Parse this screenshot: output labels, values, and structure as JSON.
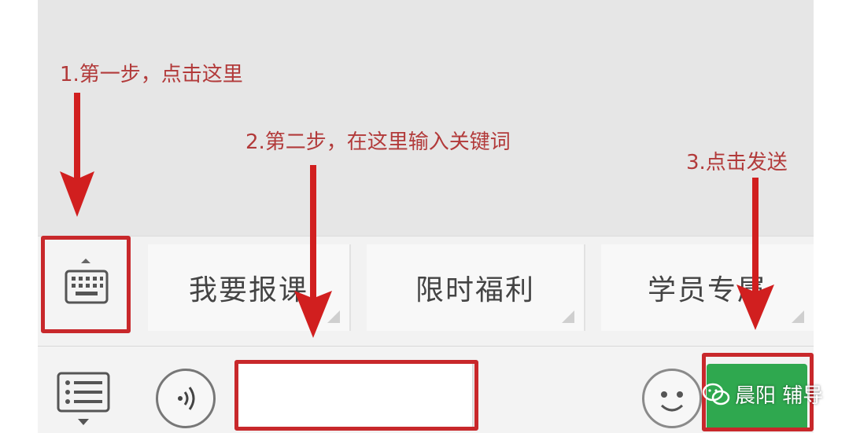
{
  "annotations": {
    "step1": "1.第一步，点击这里",
    "step2": "2.第二步，在这里输入关键词",
    "step3": "3.点击发送"
  },
  "menu": {
    "items": [
      {
        "label": "我要报课"
      },
      {
        "label": "限时福利"
      },
      {
        "label": "学员专属"
      }
    ]
  },
  "input_bar": {
    "send_label": ""
  },
  "watermark": {
    "text": "晨阳 辅导"
  },
  "colors": {
    "highlight": "#c8282b",
    "arrow": "#d11f1f",
    "send": "#2fa84f",
    "annotation_text": "#b23a3a"
  },
  "icons": [
    "keyboard-icon",
    "menu-list-icon",
    "voice-icon",
    "emoji-icon",
    "wechat-icon",
    "arrow-down-icon"
  ]
}
